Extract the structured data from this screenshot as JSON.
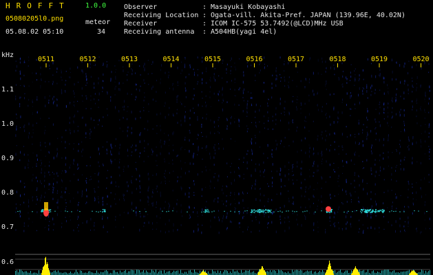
{
  "header": {
    "title": "HROFFT",
    "version": "1.0.0",
    "filename": "05080205l0.png",
    "datetime": "05.08.02 05:10",
    "meteor_label": "meteor",
    "meteor_count": "34"
  },
  "info": [
    {
      "key": "Observer",
      "value": "Masayuki Kobayashi"
    },
    {
      "key": "Receiving Location",
      "value": "Ogata-vill. Akita-Pref. JAPAN (139.96E, 40.02N)"
    },
    {
      "key": "Receiver",
      "value": "ICOM IC-575 53.7492(@LCD)MHz USB"
    },
    {
      "key": "Receiving antenna",
      "value": "A504HB(yagi 4el)"
    }
  ],
  "axis": {
    "unit": "kHz",
    "y_ticks": [
      "1.1",
      "1.0",
      "0.9",
      "0.8",
      "0.7",
      "0.6"
    ],
    "time_labels": [
      "0511",
      "0512",
      "0513",
      "0514",
      "0515",
      "0516",
      "0517",
      "0518",
      "0519",
      "0520"
    ]
  },
  "colors": {
    "header_text": "#e8e8e8",
    "title": "#ffe000",
    "time_labels": "#ffe000",
    "green_text": "#40ff40",
    "background": "#000000",
    "noise": "#1a2fb0",
    "trace": "#30e0e0",
    "peak": "#ff4040",
    "activity": "#ffee00"
  }
}
